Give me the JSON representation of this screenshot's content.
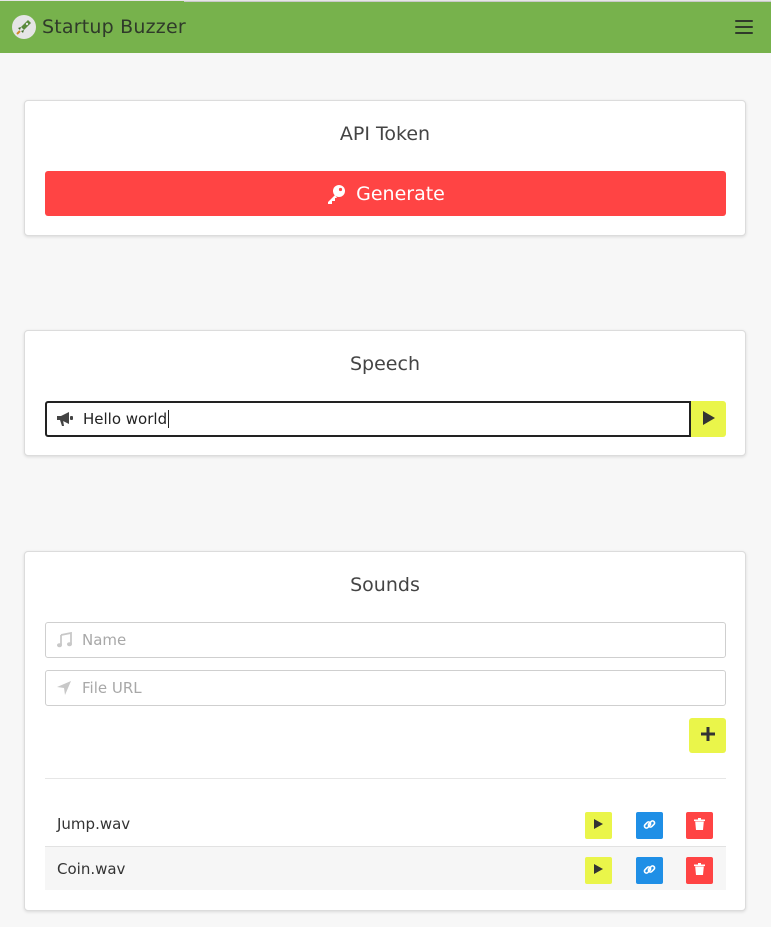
{
  "app": {
    "title": "Startup Buzzer"
  },
  "colors": {
    "brand": "#77b24c",
    "danger": "#ff4444",
    "accent": "#eaf54a",
    "info": "#1f8fe6"
  },
  "token": {
    "title": "API Token",
    "generate_label": "Generate",
    "icon": "key-icon"
  },
  "speech": {
    "title": "Speech",
    "input_value": "Hello world",
    "icon": "megaphone-icon",
    "play_icon": "play-icon"
  },
  "sounds": {
    "title": "Sounds",
    "name_placeholder": "Name",
    "url_placeholder": "File URL",
    "name_icon": "music-icon",
    "url_icon": "location-arrow-icon",
    "add_icon": "plus-icon",
    "items": [
      {
        "name": "Jump.wav"
      },
      {
        "name": "Coin.wav"
      }
    ]
  }
}
